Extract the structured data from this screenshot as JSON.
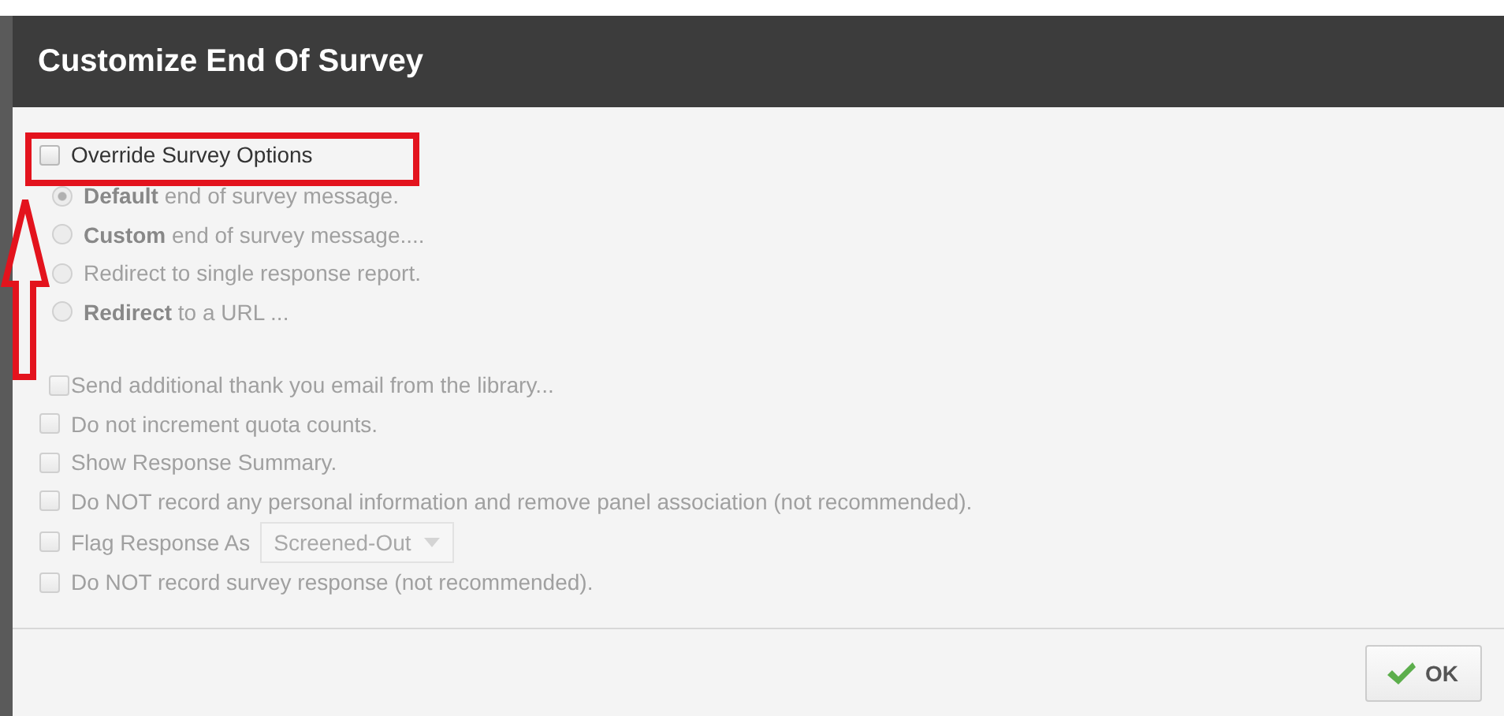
{
  "dialog": {
    "title": "Customize End Of Survey"
  },
  "override": {
    "label": "Override Survey Options",
    "checked": false,
    "highlighted": true
  },
  "end_options": [
    {
      "label": "**Default** end of survey message.",
      "selected": true,
      "disabled": true
    },
    {
      "label": "**Custom** end of survey message....",
      "selected": false,
      "disabled": true
    },
    {
      "label": "Redirect to single response report.",
      "selected": false,
      "disabled": true
    },
    {
      "label": "**Redirect** to a URL ...",
      "selected": false,
      "disabled": true
    }
  ],
  "options": [
    {
      "kind": "checkbox",
      "label": "Send additional thank you email from the library...",
      "checked": false,
      "disabled": true
    },
    {
      "kind": "checkbox",
      "label": "Do not increment quota counts.",
      "checked": false,
      "disabled": true
    },
    {
      "kind": "checkbox",
      "label": "Show Response Summary.",
      "checked": false,
      "disabled": true
    },
    {
      "kind": "checkbox",
      "label": "Do NOT record any personal information and remove panel association (not recommended).",
      "checked": false,
      "disabled": true
    },
    {
      "kind": "dropdown",
      "label": "Flag Response As",
      "checked": false,
      "disabled": true,
      "value": "Screened-Out"
    },
    {
      "kind": "checkbox",
      "label": "Do NOT record survey response (not recommended).",
      "checked": false,
      "disabled": true
    }
  ],
  "buttons": [
    {
      "label": "OK"
    }
  ]
}
